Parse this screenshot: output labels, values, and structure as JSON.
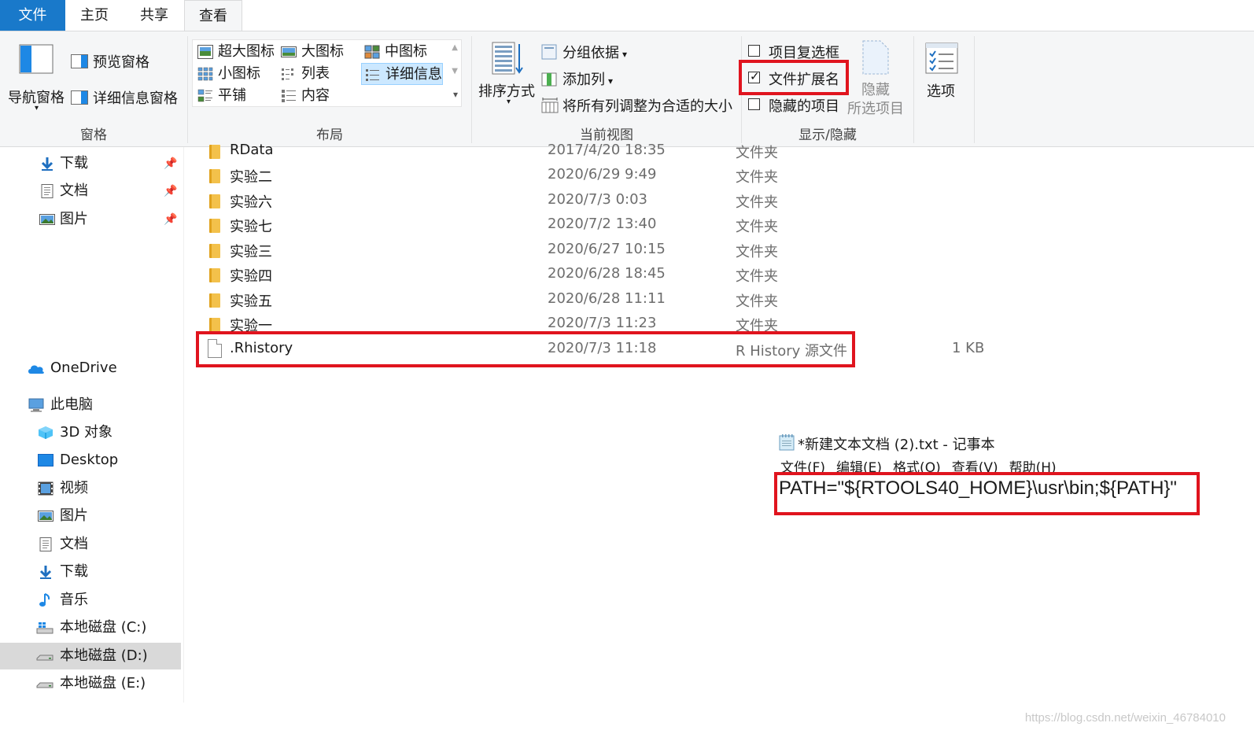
{
  "tabs": {
    "file": "文件",
    "home": "主页",
    "share": "共享",
    "view": "查看"
  },
  "ribbon": {
    "panes": {
      "nav_pane": "导航窗格",
      "preview_pane": "预览窗格",
      "details_pane": "详细信息窗格",
      "label": "窗格"
    },
    "layout": {
      "items": [
        "超大图标",
        "大图标",
        "中图标",
        "小图标",
        "列表",
        "详细信息",
        "平铺",
        "内容"
      ],
      "selected": "详细信息",
      "label": "布局"
    },
    "current_view": {
      "sort_by": "排序方式",
      "group_by": "分组依据",
      "add_column": "添加列",
      "fit_columns": "将所有列调整为合适的大小",
      "label": "当前视图"
    },
    "show_hide": {
      "item_checkboxes": "项目复选框",
      "item_checkboxes_checked": false,
      "file_extensions": "文件扩展名",
      "file_extensions_checked": true,
      "hidden_items": "隐藏的项目",
      "hidden_items_checked": false,
      "hide": "隐藏",
      "selected_items": "所选项目",
      "label": "显示/隐藏"
    },
    "options": "选项"
  },
  "nav": {
    "quick_access": [
      {
        "label": "下载",
        "icon": "download-arrow-icon"
      },
      {
        "label": "文档",
        "icon": "document-icon"
      },
      {
        "label": "图片",
        "icon": "picture-icon"
      }
    ],
    "onedrive": "OneDrive",
    "this_pc": "此电脑",
    "pc_items": [
      {
        "label": "3D 对象",
        "icon": "3d-objects-icon"
      },
      {
        "label": "Desktop",
        "icon": "desktop-icon"
      },
      {
        "label": "视频",
        "icon": "video-icon"
      },
      {
        "label": "图片",
        "icon": "picture-icon"
      },
      {
        "label": "文档",
        "icon": "document-icon"
      },
      {
        "label": "下载",
        "icon": "download-arrow-icon"
      },
      {
        "label": "音乐",
        "icon": "music-icon"
      },
      {
        "label": "本地磁盘 (C:)",
        "icon": "drive-c-icon"
      },
      {
        "label": "本地磁盘 (D:)",
        "icon": "drive-icon"
      },
      {
        "label": "本地磁盘 (E:)",
        "icon": "drive-icon"
      }
    ],
    "selected": "本地磁盘 (D:)"
  },
  "files": [
    {
      "name": "RData",
      "date": "2017/4/20 18:35",
      "type": "文件夹",
      "size": "",
      "kind": "folder"
    },
    {
      "name": "实验二",
      "date": "2020/6/29 9:49",
      "type": "文件夹",
      "size": "",
      "kind": "folder"
    },
    {
      "name": "实验六",
      "date": "2020/7/3 0:03",
      "type": "文件夹",
      "size": "",
      "kind": "folder"
    },
    {
      "name": "实验七",
      "date": "2020/7/2 13:40",
      "type": "文件夹",
      "size": "",
      "kind": "folder"
    },
    {
      "name": "实验三",
      "date": "2020/6/27 10:15",
      "type": "文件夹",
      "size": "",
      "kind": "folder"
    },
    {
      "name": "实验四",
      "date": "2020/6/28 18:45",
      "type": "文件夹",
      "size": "",
      "kind": "folder"
    },
    {
      "name": "实验五",
      "date": "2020/6/28 11:11",
      "type": "文件夹",
      "size": "",
      "kind": "folder"
    },
    {
      "name": "实验一",
      "date": "2020/7/3 11:23",
      "type": "文件夹",
      "size": "",
      "kind": "folder"
    },
    {
      "name": ".Rhistory",
      "date": "2020/7/3 11:18",
      "type": "R History 源文件",
      "size": "1 KB",
      "kind": "file"
    }
  ],
  "notepad": {
    "title": "*新建文本文档 (2).txt - 记事本",
    "menu": [
      "文件(F)",
      "编辑(E)",
      "格式(O)",
      "查看(V)",
      "帮助(H)"
    ],
    "content": "PATH=\"${RTOOLS40_HOME}\\usr\\bin;${PATH}\""
  },
  "watermark": "https://blog.csdn.net/weixin_46784010",
  "colors": {
    "file_tab": "#1979ca",
    "highlight_box": "#e0141e",
    "selection": "#cce8ff",
    "folder": "#f3c14b"
  }
}
